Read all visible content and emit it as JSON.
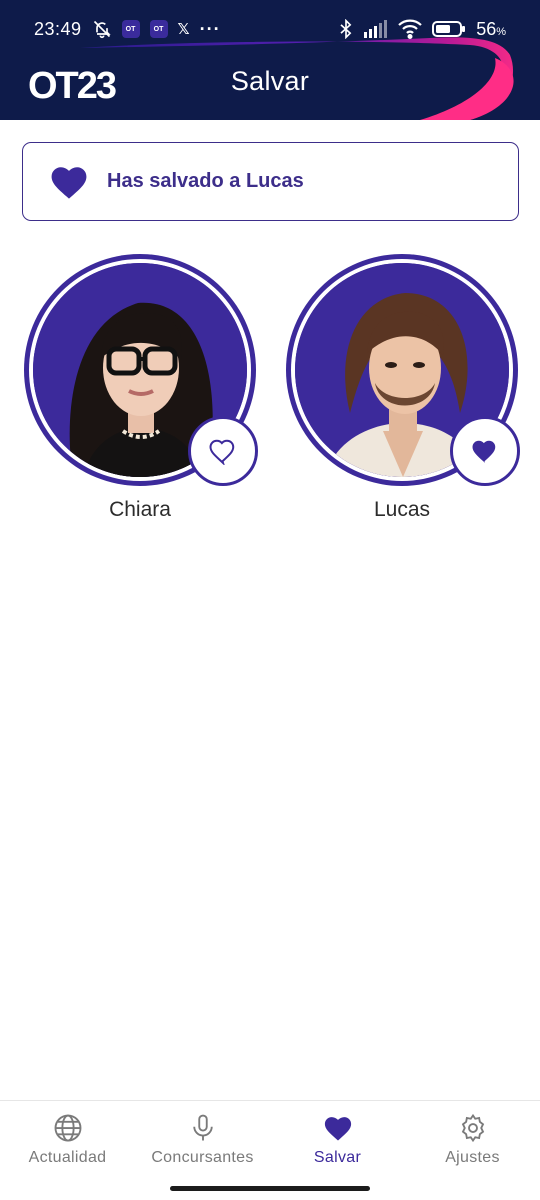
{
  "status_bar": {
    "time": "23:49",
    "battery": "56",
    "battery_unit": "%",
    "app_badge_1": "OT",
    "app_badge_2": "OT",
    "x_icon": "𝕏",
    "more": "···"
  },
  "app_bar": {
    "logo_text": "OT23",
    "title": "Salvar"
  },
  "banner": {
    "text": "Has salvado a Lucas"
  },
  "contestants": [
    {
      "name": "Chiara",
      "saved": false
    },
    {
      "name": "Lucas",
      "saved": true
    }
  ],
  "nav": {
    "items": [
      {
        "label": "Actualidad",
        "icon": "globe-icon"
      },
      {
        "label": "Concursantes",
        "icon": "microphone-icon"
      },
      {
        "label": "Salvar",
        "icon": "heart-icon"
      },
      {
        "label": "Ajustes",
        "icon": "gear-icon"
      }
    ],
    "active": "Salvar"
  },
  "colors": {
    "accent": "#3c2a9b",
    "header_bg": "#0e1b4a",
    "swoosh_pink": "#e0197d",
    "nav_inactive": "#7a7a7a"
  }
}
